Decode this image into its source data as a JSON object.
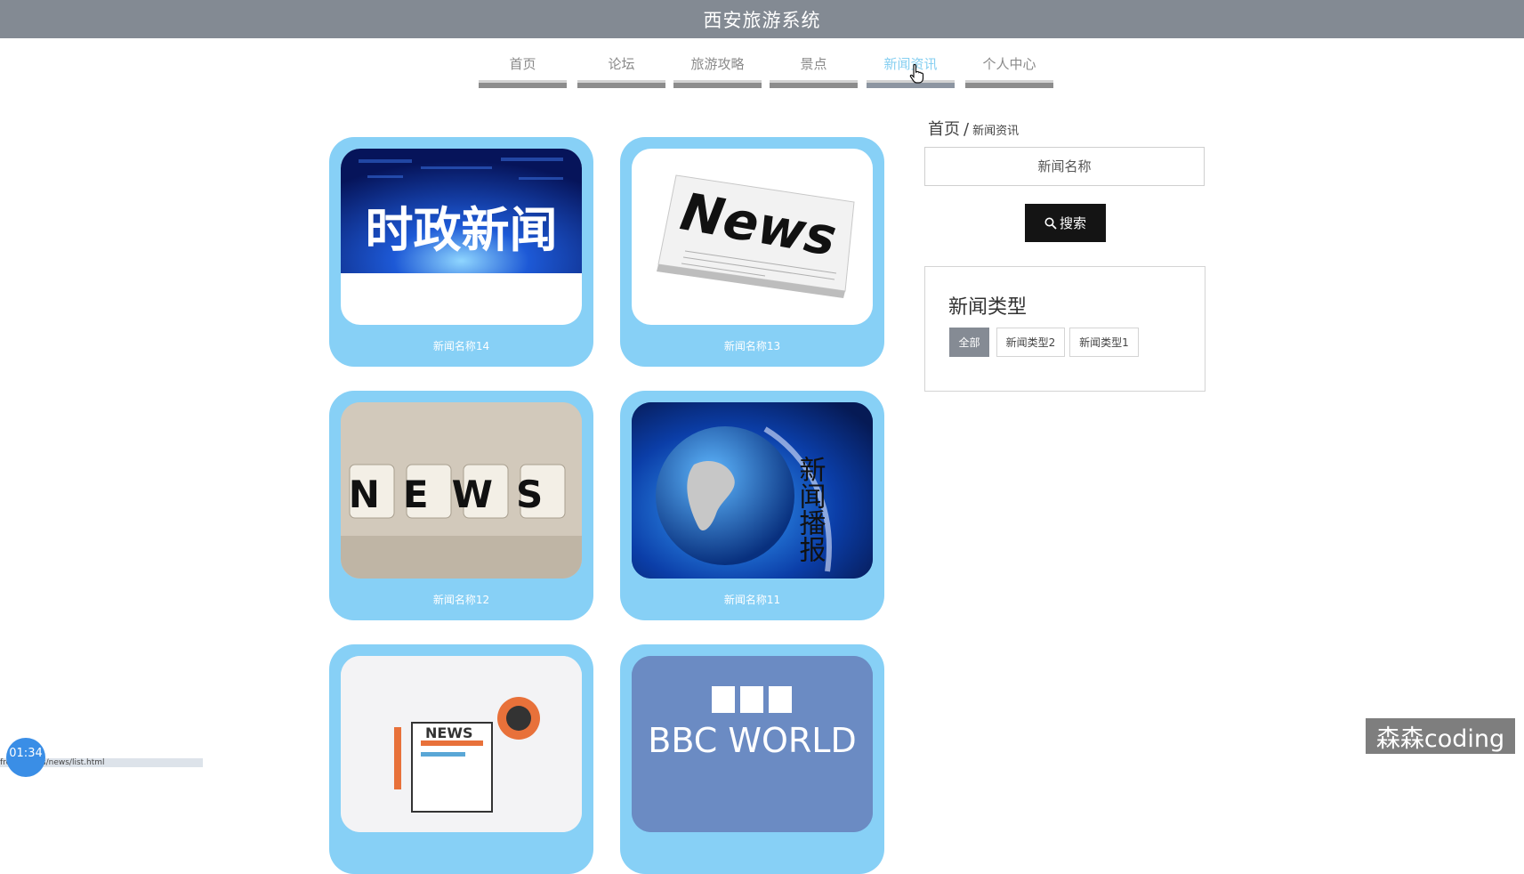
{
  "header": {
    "title": "西安旅游系统"
  },
  "nav": {
    "items": [
      {
        "label": "首页"
      },
      {
        "label": "论坛"
      },
      {
        "label": "旅游攻略"
      },
      {
        "label": "景点"
      },
      {
        "label": "新闻资讯",
        "active": true
      },
      {
        "label": "个人中心"
      }
    ]
  },
  "news": {
    "cards": [
      {
        "name": "新闻名称14",
        "image_text": "时政新闻"
      },
      {
        "name": "新闻名称13",
        "image_text": "News"
      },
      {
        "name": "新闻名称12",
        "image_text": "NEWS"
      },
      {
        "name": "新闻名称11",
        "image_text": "新闻播报"
      },
      {
        "name": "",
        "image_text": "NEWS"
      },
      {
        "name": "",
        "image_text": "BBC WORLD"
      }
    ]
  },
  "sidebar": {
    "breadcrumb": {
      "home": "首页",
      "separator": "/",
      "current": "新闻资讯"
    },
    "search": {
      "placeholder": "新闻名称",
      "value": "",
      "button_label": "搜索"
    },
    "types": {
      "title": "新闻类型",
      "tags": [
        {
          "label": "全部",
          "active": true
        },
        {
          "label": "新闻类型2"
        },
        {
          "label": "新闻类型1"
        }
      ]
    }
  },
  "overlay": {
    "timer": "01:34",
    "status_url": "front/pages/news/list.html",
    "watermark": "森森coding"
  },
  "colors": {
    "header_bg": "#838a93",
    "card_bg": "#87d0f6",
    "nav_active": "#86cff1",
    "search_button_bg": "#141414",
    "tag_active_bg": "#858b94"
  }
}
